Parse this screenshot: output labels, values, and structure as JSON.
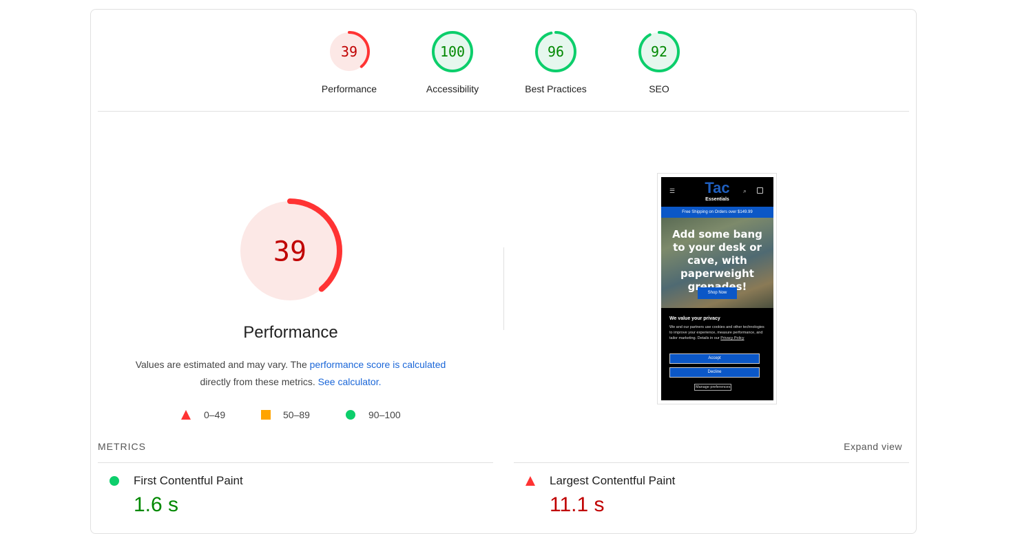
{
  "categories": [
    {
      "label": "Performance",
      "score": "39",
      "fraction": 0.39,
      "color": "#ff3333",
      "track": "#fce8e6",
      "bg": "#fce8e6",
      "textcolor": "#c00000"
    },
    {
      "label": "Accessibility",
      "score": "100",
      "fraction": 1.0,
      "color": "#0cce6b",
      "track": "#e6f7ee",
      "bg": "#e6f7ee",
      "textcolor": "#008800"
    },
    {
      "label": "Best Practices",
      "score": "96",
      "fraction": 0.96,
      "color": "#0cce6b",
      "track": "#e6f7ee",
      "bg": "#e6f7ee",
      "textcolor": "#008800"
    },
    {
      "label": "SEO",
      "score": "92",
      "fraction": 0.92,
      "color": "#0cce6b",
      "track": "#e6f7ee",
      "bg": "#e6f7ee",
      "textcolor": "#008800"
    }
  ],
  "performance": {
    "score": "39",
    "fraction": 0.39,
    "title": "Performance",
    "desc_1": "Values are estimated and may vary. The ",
    "desc_link_1": "performance score is calculated",
    "desc_2": "directly from these metrics. ",
    "desc_link_2": "See calculator."
  },
  "legend": [
    {
      "range": "0–49",
      "icon": "triangle-icon",
      "color": "#ff3333"
    },
    {
      "range": "50–89",
      "icon": "square-icon",
      "color": "#ffa400"
    },
    {
      "range": "90–100",
      "icon": "circle-icon",
      "color": "#0cce6b"
    }
  ],
  "screenshot": {
    "logo": "Tac",
    "logo_sub": "Essentials",
    "banner": "Free Shipping on Orders over $149.99",
    "hero_text": "Add some bang to your desk or cave, with paperweight grenades!",
    "shop_button": "Shop Now",
    "privacy_title": "We value your privacy",
    "privacy_text": "We and our partners use cookies and other technologies to improve your experience, measure performance, and tailor marketing. Details in our ",
    "privacy_link": "Privacy Policy",
    "accept": "Accept",
    "decline": "Decline",
    "manage": "Manage preferences"
  },
  "metrics": {
    "heading": "METRICS",
    "expand": "Expand view",
    "items": [
      {
        "name": "First Contentful Paint",
        "value": "1.6 s",
        "status": "circle-icon",
        "color": "#0cce6b",
        "valcolor": "#008800"
      },
      {
        "name": "Largest Contentful Paint",
        "value": "11.1 s",
        "status": "triangle-icon",
        "color": "#ff3333",
        "valcolor": "#c00000"
      }
    ]
  }
}
